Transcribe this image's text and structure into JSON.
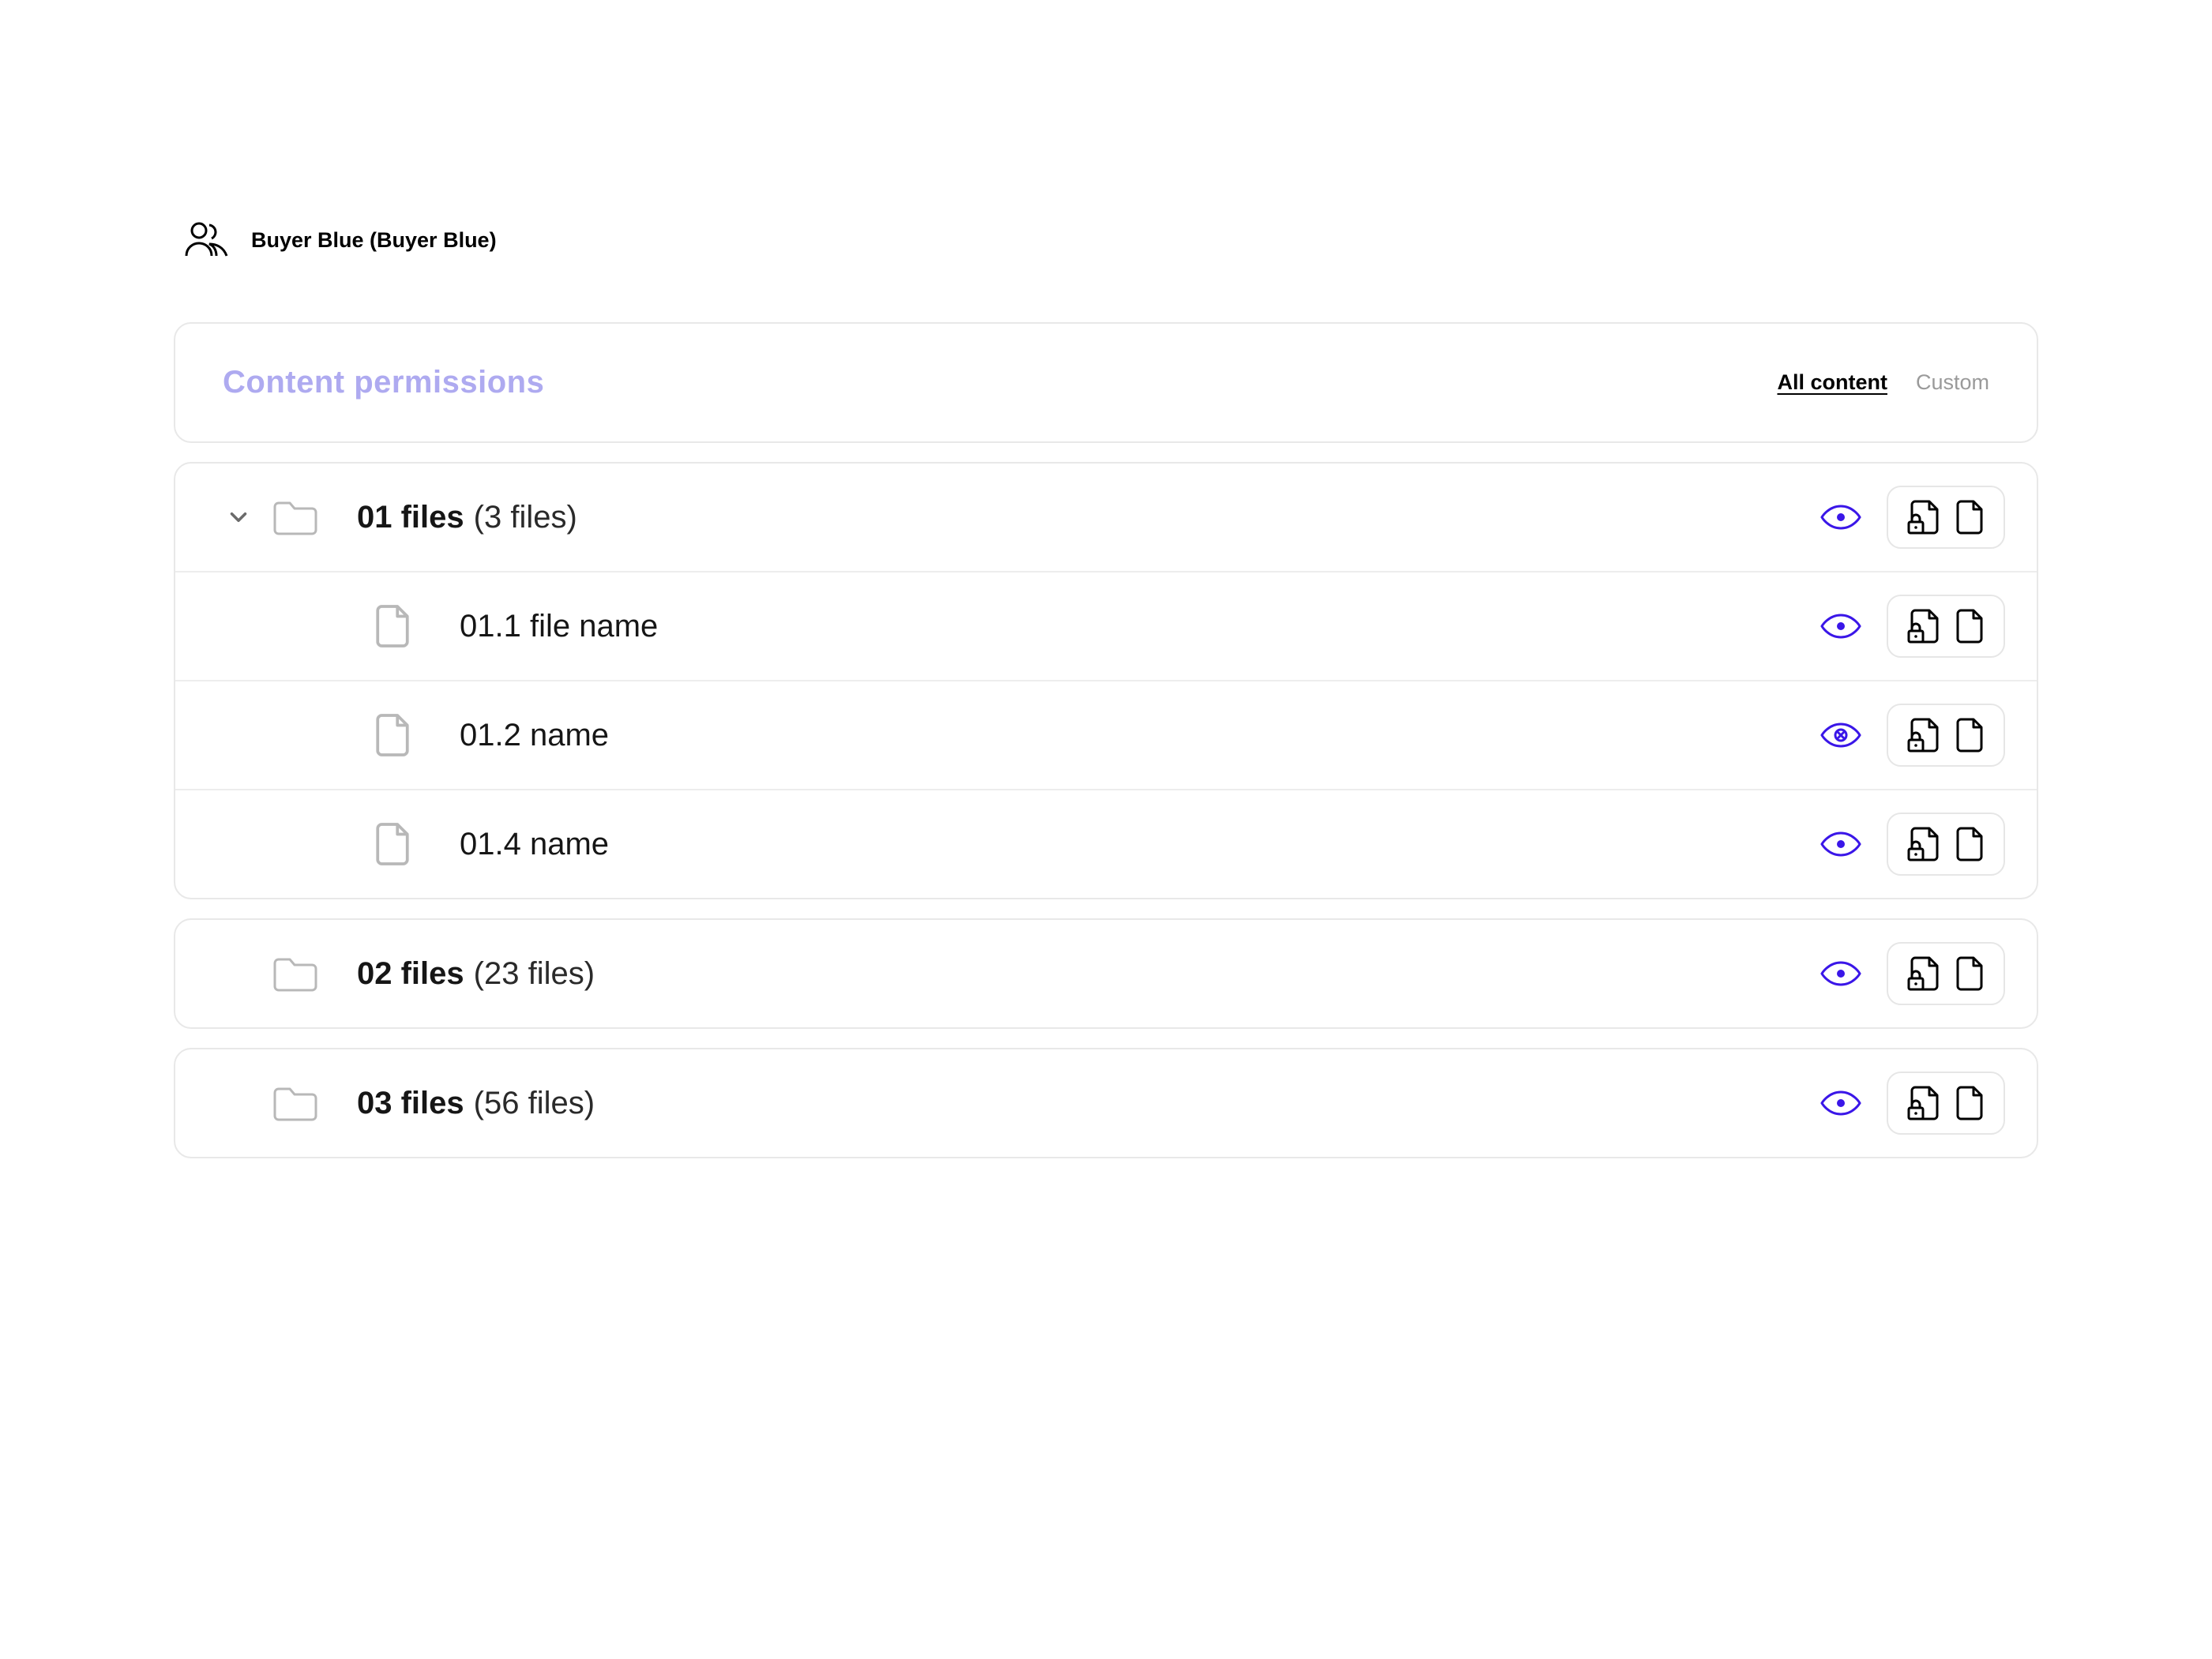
{
  "user": {
    "label": "Buyer Blue (Buyer Blue)"
  },
  "permissions_panel": {
    "title": "Content permissions",
    "tabs": {
      "all": "All content ",
      "custom": "Custom",
      "active": "all"
    }
  },
  "colors": {
    "accent": "#3a16e8",
    "title_soft": "#aeaaf0"
  },
  "tree": [
    {
      "type": "folder",
      "expanded": true,
      "name": "01 files",
      "count_label": "(3 files)",
      "visibility": "visible",
      "children": [
        {
          "type": "file",
          "name": "01.1 file name",
          "visibility": "visible"
        },
        {
          "type": "file",
          "name": "01.2  name",
          "visibility": "blocked"
        },
        {
          "type": "file",
          "name": "01.4 name",
          "visibility": "visible"
        }
      ]
    },
    {
      "type": "folder",
      "expanded": false,
      "name": "02 files",
      "count_label": "(23 files)",
      "visibility": "visible",
      "children": []
    },
    {
      "type": "folder",
      "expanded": false,
      "name": "03 files",
      "count_label": "(56 files)",
      "visibility": "visible",
      "children": []
    }
  ]
}
